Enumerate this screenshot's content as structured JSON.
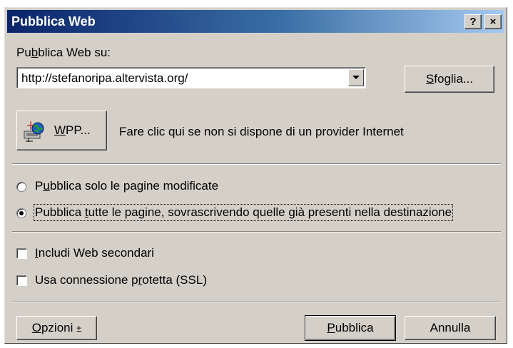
{
  "window": {
    "title": "Pubblica Web",
    "help_button": "?",
    "close_button": "×"
  },
  "publish_to": {
    "label_pre": "Pu",
    "label_key": "b",
    "label_post": "blica Web su:",
    "url_value": "http://stefanoripa.altervista.org/",
    "browse_key": "S",
    "browse_rest": "foglia..."
  },
  "wpp": {
    "button_key": "W",
    "button_rest": "PP...",
    "icon": "globe-computer-icon",
    "description": "Fare clic qui se non si dispone di un provider Internet"
  },
  "options": {
    "radio_changed_pre": "P",
    "radio_changed_key": "u",
    "radio_changed_post": "bblica solo le pagine modificate",
    "radio_changed_selected": false,
    "radio_all_pre": "Pubblica ",
    "radio_all_key": "t",
    "radio_all_post": "utte le pagine, sovrascrivendo quelle già presenti nella destinazione",
    "radio_all_selected": true,
    "include_subwebs_key": "I",
    "include_subwebs_post": "ncludi Web secondari",
    "include_subwebs_checked": false,
    "ssl_pre": "Usa connessione p",
    "ssl_key": "r",
    "ssl_post": "otetta (SSL)",
    "ssl_checked": false
  },
  "footer": {
    "options_key": "O",
    "options_rest": "pzioni",
    "options_arrow": "±",
    "publish_key": "P",
    "publish_rest": "ubblica",
    "cancel": "Annulla"
  }
}
